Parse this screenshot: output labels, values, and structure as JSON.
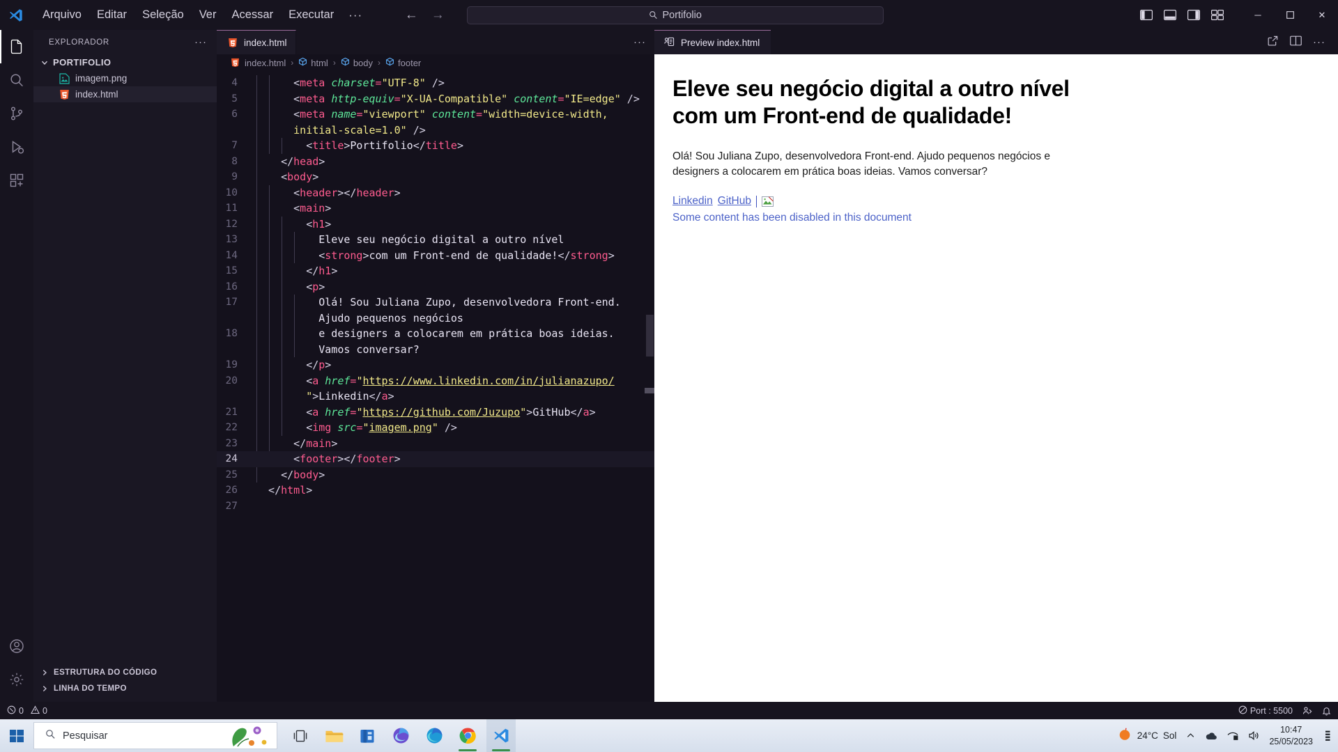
{
  "titlebar": {
    "menu": [
      "Arquivo",
      "Editar",
      "Seleção",
      "Ver",
      "Acessar",
      "Executar"
    ],
    "menu_more": "···",
    "search_value": "Portifolio",
    "back_label": "←",
    "forward_label": "→",
    "minimize": "─",
    "maximize": "☐",
    "close": "✕"
  },
  "activitybar": {
    "items": [
      {
        "name": "explorer",
        "icon": "files-icon"
      },
      {
        "name": "search",
        "icon": "search-icon"
      },
      {
        "name": "source-control",
        "icon": "source-control-icon"
      },
      {
        "name": "run-debug",
        "icon": "run-debug-icon"
      },
      {
        "name": "extensions",
        "icon": "extensions-icon"
      }
    ],
    "bottom": [
      {
        "name": "accounts",
        "icon": "account-icon"
      },
      {
        "name": "settings",
        "icon": "gear-icon"
      }
    ]
  },
  "sidebar": {
    "title": "EXPLORADOR",
    "more": "···",
    "root_folder": "PORTIFOLIO",
    "files": [
      {
        "name": "imagem.png",
        "icon": "image-file-icon",
        "selected": false
      },
      {
        "name": "index.html",
        "icon": "html-file-icon",
        "selected": true
      }
    ],
    "sections": [
      "ESTRUTURA DO CÓDIGO",
      "LINHA DO TEMPO"
    ]
  },
  "editor": {
    "tab_label": "index.html",
    "tab_actions": "···",
    "breadcrumbs": [
      "index.html",
      "html",
      "body",
      "footer"
    ],
    "active_line": 24,
    "lines": [
      {
        "num": "4",
        "indent": 3,
        "tokens": [
          {
            "t": "punct",
            "v": "<"
          },
          {
            "t": "tag",
            "v": "meta"
          },
          {
            "t": "text",
            "v": " "
          },
          {
            "t": "attr",
            "v": "charset"
          },
          {
            "t": "eq",
            "v": "="
          },
          {
            "t": "str",
            "v": "\"UTF-8\""
          },
          {
            "t": "punct",
            "v": " />"
          }
        ]
      },
      {
        "num": "5",
        "indent": 3,
        "tokens": [
          {
            "t": "punct",
            "v": "<"
          },
          {
            "t": "tag",
            "v": "meta"
          },
          {
            "t": "text",
            "v": " "
          },
          {
            "t": "attr",
            "v": "http-equiv"
          },
          {
            "t": "eq",
            "v": "="
          },
          {
            "t": "str",
            "v": "\"X-UA-Compatible\""
          },
          {
            "t": "text",
            "v": " "
          },
          {
            "t": "attr",
            "v": "content"
          },
          {
            "t": "eq",
            "v": "="
          },
          {
            "t": "str",
            "v": "\"IE=edge\""
          },
          {
            "t": "punct",
            "v": " />"
          }
        ]
      },
      {
        "num": "6",
        "indent": 3,
        "tokens": [
          {
            "t": "punct",
            "v": "<"
          },
          {
            "t": "tag",
            "v": "meta"
          },
          {
            "t": "text",
            "v": " "
          },
          {
            "t": "attr",
            "v": "name"
          },
          {
            "t": "eq",
            "v": "="
          },
          {
            "t": "str",
            "v": "\"viewport\""
          },
          {
            "t": "text",
            "v": " "
          },
          {
            "t": "attr",
            "v": "content"
          },
          {
            "t": "eq",
            "v": "="
          },
          {
            "t": "str",
            "v": "\"width=device-width,"
          }
        ]
      },
      {
        "num": "",
        "indent": 3,
        "tokens": [
          {
            "t": "str",
            "v": "initial-scale=1.0\""
          },
          {
            "t": "punct",
            "v": " />"
          }
        ]
      },
      {
        "num": "7",
        "indent": 4,
        "tokens": [
          {
            "t": "punct",
            "v": "<"
          },
          {
            "t": "tag",
            "v": "title"
          },
          {
            "t": "punct",
            "v": ">"
          },
          {
            "t": "text",
            "v": "Portifolio"
          },
          {
            "t": "punct",
            "v": "</"
          },
          {
            "t": "tag",
            "v": "title"
          },
          {
            "t": "punct",
            "v": ">"
          }
        ]
      },
      {
        "num": "8",
        "indent": 2,
        "tokens": [
          {
            "t": "punct",
            "v": "</"
          },
          {
            "t": "tag",
            "v": "head"
          },
          {
            "t": "punct",
            "v": ">"
          }
        ]
      },
      {
        "num": "9",
        "indent": 2,
        "tokens": [
          {
            "t": "punct",
            "v": "<"
          },
          {
            "t": "tag",
            "v": "body"
          },
          {
            "t": "punct",
            "v": ">"
          }
        ]
      },
      {
        "num": "10",
        "indent": 3,
        "tokens": [
          {
            "t": "punct",
            "v": "<"
          },
          {
            "t": "tag",
            "v": "header"
          },
          {
            "t": "punct",
            "v": "></"
          },
          {
            "t": "tag",
            "v": "header"
          },
          {
            "t": "punct",
            "v": ">"
          }
        ]
      },
      {
        "num": "11",
        "indent": 3,
        "tokens": [
          {
            "t": "punct",
            "v": "<"
          },
          {
            "t": "tag",
            "v": "main"
          },
          {
            "t": "punct",
            "v": ">"
          }
        ]
      },
      {
        "num": "12",
        "indent": 4,
        "tokens": [
          {
            "t": "punct",
            "v": "<"
          },
          {
            "t": "tag",
            "v": "h1"
          },
          {
            "t": "punct",
            "v": ">"
          }
        ]
      },
      {
        "num": "13",
        "indent": 5,
        "tokens": [
          {
            "t": "text",
            "v": "Eleve seu negócio digital a outro nível"
          }
        ]
      },
      {
        "num": "14",
        "indent": 5,
        "tokens": [
          {
            "t": "punct",
            "v": "<"
          },
          {
            "t": "tag",
            "v": "strong"
          },
          {
            "t": "punct",
            "v": ">"
          },
          {
            "t": "text",
            "v": "com um Front-end de qualidade!"
          },
          {
            "t": "punct",
            "v": "</"
          },
          {
            "t": "tag",
            "v": "strong"
          },
          {
            "t": "punct",
            "v": ">"
          }
        ]
      },
      {
        "num": "15",
        "indent": 4,
        "tokens": [
          {
            "t": "punct",
            "v": "</"
          },
          {
            "t": "tag",
            "v": "h1"
          },
          {
            "t": "punct",
            "v": ">"
          }
        ]
      },
      {
        "num": "16",
        "indent": 4,
        "tokens": [
          {
            "t": "punct",
            "v": "<"
          },
          {
            "t": "tag",
            "v": "p"
          },
          {
            "t": "punct",
            "v": ">"
          }
        ]
      },
      {
        "num": "17",
        "indent": 5,
        "tokens": [
          {
            "t": "text",
            "v": "Olá! Sou Juliana Zupo, desenvolvedora Front-end."
          }
        ]
      },
      {
        "num": "",
        "indent": 5,
        "tokens": [
          {
            "t": "text",
            "v": "Ajudo pequenos negócios"
          }
        ]
      },
      {
        "num": "18",
        "indent": 5,
        "tokens": [
          {
            "t": "text",
            "v": "e designers a colocarem em prática boas ideias."
          }
        ]
      },
      {
        "num": "",
        "indent": 5,
        "tokens": [
          {
            "t": "text",
            "v": "Vamos conversar?"
          }
        ]
      },
      {
        "num": "19",
        "indent": 4,
        "tokens": [
          {
            "t": "punct",
            "v": "</"
          },
          {
            "t": "tag",
            "v": "p"
          },
          {
            "t": "punct",
            "v": ">"
          }
        ]
      },
      {
        "num": "20",
        "indent": 4,
        "tokens": [
          {
            "t": "punct",
            "v": "<"
          },
          {
            "t": "tag",
            "v": "a"
          },
          {
            "t": "text",
            "v": " "
          },
          {
            "t": "attr",
            "v": "href"
          },
          {
            "t": "eq",
            "v": "="
          },
          {
            "t": "str",
            "v": "\""
          },
          {
            "t": "link",
            "v": "https://www.linkedin.com/in/julianazupo/"
          }
        ]
      },
      {
        "num": "",
        "indent": 4,
        "tokens": [
          {
            "t": "str",
            "v": "\""
          },
          {
            "t": "punct",
            "v": ">"
          },
          {
            "t": "text",
            "v": "Linkedin"
          },
          {
            "t": "punct",
            "v": "</"
          },
          {
            "t": "tag",
            "v": "a"
          },
          {
            "t": "punct",
            "v": ">"
          }
        ]
      },
      {
        "num": "21",
        "indent": 4,
        "tokens": [
          {
            "t": "punct",
            "v": "<"
          },
          {
            "t": "tag",
            "v": "a"
          },
          {
            "t": "text",
            "v": " "
          },
          {
            "t": "attr",
            "v": "href"
          },
          {
            "t": "eq",
            "v": "="
          },
          {
            "t": "str",
            "v": "\""
          },
          {
            "t": "link",
            "v": "https://github.com/Juzupo"
          },
          {
            "t": "str",
            "v": "\""
          },
          {
            "t": "punct",
            "v": ">"
          },
          {
            "t": "text",
            "v": "GitHub"
          },
          {
            "t": "punct",
            "v": "</"
          },
          {
            "t": "tag",
            "v": "a"
          },
          {
            "t": "punct",
            "v": ">"
          }
        ]
      },
      {
        "num": "22",
        "indent": 4,
        "tokens": [
          {
            "t": "punct",
            "v": "<"
          },
          {
            "t": "tag",
            "v": "img"
          },
          {
            "t": "text",
            "v": " "
          },
          {
            "t": "attr",
            "v": "src"
          },
          {
            "t": "eq",
            "v": "="
          },
          {
            "t": "str",
            "v": "\""
          },
          {
            "t": "link",
            "v": "imagem.png"
          },
          {
            "t": "str",
            "v": "\""
          },
          {
            "t": "punct",
            "v": " />"
          }
        ]
      },
      {
        "num": "23",
        "indent": 3,
        "tokens": [
          {
            "t": "punct",
            "v": "</"
          },
          {
            "t": "tag",
            "v": "main"
          },
          {
            "t": "punct",
            "v": ">"
          }
        ]
      },
      {
        "num": "24",
        "indent": 3,
        "tokens": [
          {
            "t": "punct",
            "v": "<"
          },
          {
            "t": "tag",
            "v": "footer"
          },
          {
            "t": "punct",
            "v": "></"
          },
          {
            "t": "tag",
            "v": "footer"
          },
          {
            "t": "punct",
            "v": ">"
          }
        ]
      },
      {
        "num": "25",
        "indent": 2,
        "tokens": [
          {
            "t": "punct",
            "v": "</"
          },
          {
            "t": "tag",
            "v": "body"
          },
          {
            "t": "punct",
            "v": ">"
          }
        ]
      },
      {
        "num": "26",
        "indent": 1,
        "tokens": [
          {
            "t": "punct",
            "v": "</"
          },
          {
            "t": "tag",
            "v": "html"
          },
          {
            "t": "punct",
            "v": ">"
          }
        ]
      },
      {
        "num": "27",
        "indent": 1,
        "tokens": []
      }
    ]
  },
  "preview": {
    "tab_label": "Preview index.html",
    "heading": "Eleve seu negócio digital a outro nível com um Front-end de qualidade!",
    "paragraph": "Olá! Sou Juliana Zupo, desenvolvedora Front-end. Ajudo pequenos negócios e designers a colocarem em prática boas ideias. Vamos conversar?",
    "link_linkedin": "Linkedin",
    "link_github": "GitHub",
    "disabled_notice": "Some content has been disabled in this document"
  },
  "statusbar": {
    "errors": "0",
    "warnings": "0",
    "port": "Port : 5500"
  },
  "taskbar": {
    "search_placeholder": "Pesquisar",
    "weather_temp": "24°C",
    "weather_desc": "Sol",
    "time": "10:47",
    "date": "25/05/2023"
  },
  "colors": {
    "accent_tab_border": "#9b6d9b",
    "editor_bg": "#14111c",
    "sidebar_bg": "#1a1723",
    "tag": "#ff5c8f",
    "attr": "#5ee89a",
    "string": "#f2e98a",
    "link": "#4c62c8"
  }
}
